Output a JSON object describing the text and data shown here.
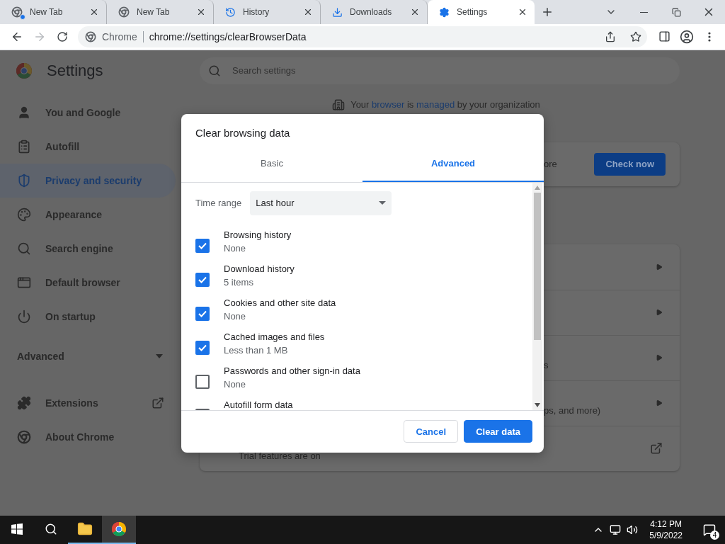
{
  "browser": {
    "tabs": [
      {
        "title": "New Tab",
        "kind": "chrome",
        "attention": true,
        "selected": false
      },
      {
        "title": "New Tab",
        "kind": "chrome",
        "attention": false,
        "selected": false
      },
      {
        "title": "History",
        "kind": "history",
        "attention": false,
        "selected": false
      },
      {
        "title": "Downloads",
        "kind": "download",
        "attention": false,
        "selected": false
      },
      {
        "title": "Settings",
        "kind": "settings",
        "attention": false,
        "selected": true
      }
    ],
    "site_chip": "Chrome",
    "url": "chrome://settings/clearBrowserData"
  },
  "sidebar": {
    "title": "Settings",
    "items": [
      {
        "label": "You and Google",
        "kind": "person",
        "selected": false
      },
      {
        "label": "Autofill",
        "kind": "clipboard",
        "selected": false
      },
      {
        "label": "Privacy and security",
        "kind": "shield",
        "selected": true
      },
      {
        "label": "Appearance",
        "kind": "palette",
        "selected": false
      },
      {
        "label": "Search engine",
        "kind": "search",
        "selected": false
      },
      {
        "label": "Default browser",
        "kind": "browser",
        "selected": false
      },
      {
        "label": "On startup",
        "kind": "power",
        "selected": false
      }
    ],
    "advanced": {
      "label": "Advanced",
      "expanded": false
    },
    "links": [
      {
        "label": "Extensions",
        "kind": "puzzle",
        "external": true
      },
      {
        "label": "About Chrome",
        "kind": "chrome",
        "external": false
      }
    ]
  },
  "search": {
    "placeholder": "Search settings"
  },
  "managed_notice": [
    {
      "text": "Your ",
      "link": false
    },
    {
      "text": "browser",
      "link": true
    },
    {
      "text": " is ",
      "link": false
    },
    {
      "text": "managed",
      "link": true
    },
    {
      "text": " by your organization",
      "link": false
    }
  ],
  "safety_card": {
    "text": "ore",
    "button": "Check now"
  },
  "privacy_card": {
    "rows": [
      {
        "kind": "arrow"
      },
      {
        "kind": "arrow"
      },
      {
        "kind": "arrow",
        "text": "s"
      },
      {
        "kind": "arrow",
        "text": "ps, and more)"
      },
      {
        "kind": "external",
        "text": "Trial features are on"
      }
    ]
  },
  "dialog": {
    "title": "Clear browsing data",
    "tabs": [
      {
        "label": "Basic",
        "selected": false
      },
      {
        "label": "Advanced",
        "selected": true
      }
    ],
    "time_range": {
      "label": "Time range",
      "value": "Last hour"
    },
    "items": [
      {
        "label": "Browsing history",
        "detail": "None",
        "checked": true
      },
      {
        "label": "Download history",
        "detail": "5 items",
        "checked": true
      },
      {
        "label": "Cookies and other site data",
        "detail": "None",
        "checked": true
      },
      {
        "label": "Cached images and files",
        "detail": "Less than 1 MB",
        "checked": true
      },
      {
        "label": "Passwords and other sign-in data",
        "detail": "None",
        "checked": false
      },
      {
        "label": "Autofill form data",
        "checked": false
      }
    ],
    "buttons": [
      {
        "label": "Cancel",
        "kind": "secondary"
      },
      {
        "label": "Clear data",
        "kind": "primary"
      }
    ]
  },
  "taskbar": {
    "apps": [
      {
        "kind": "folder",
        "selected": false
      },
      {
        "kind": "chrome",
        "selected": true
      }
    ],
    "time": "4:12 PM",
    "date": "5/9/2022",
    "notifications": "4"
  }
}
